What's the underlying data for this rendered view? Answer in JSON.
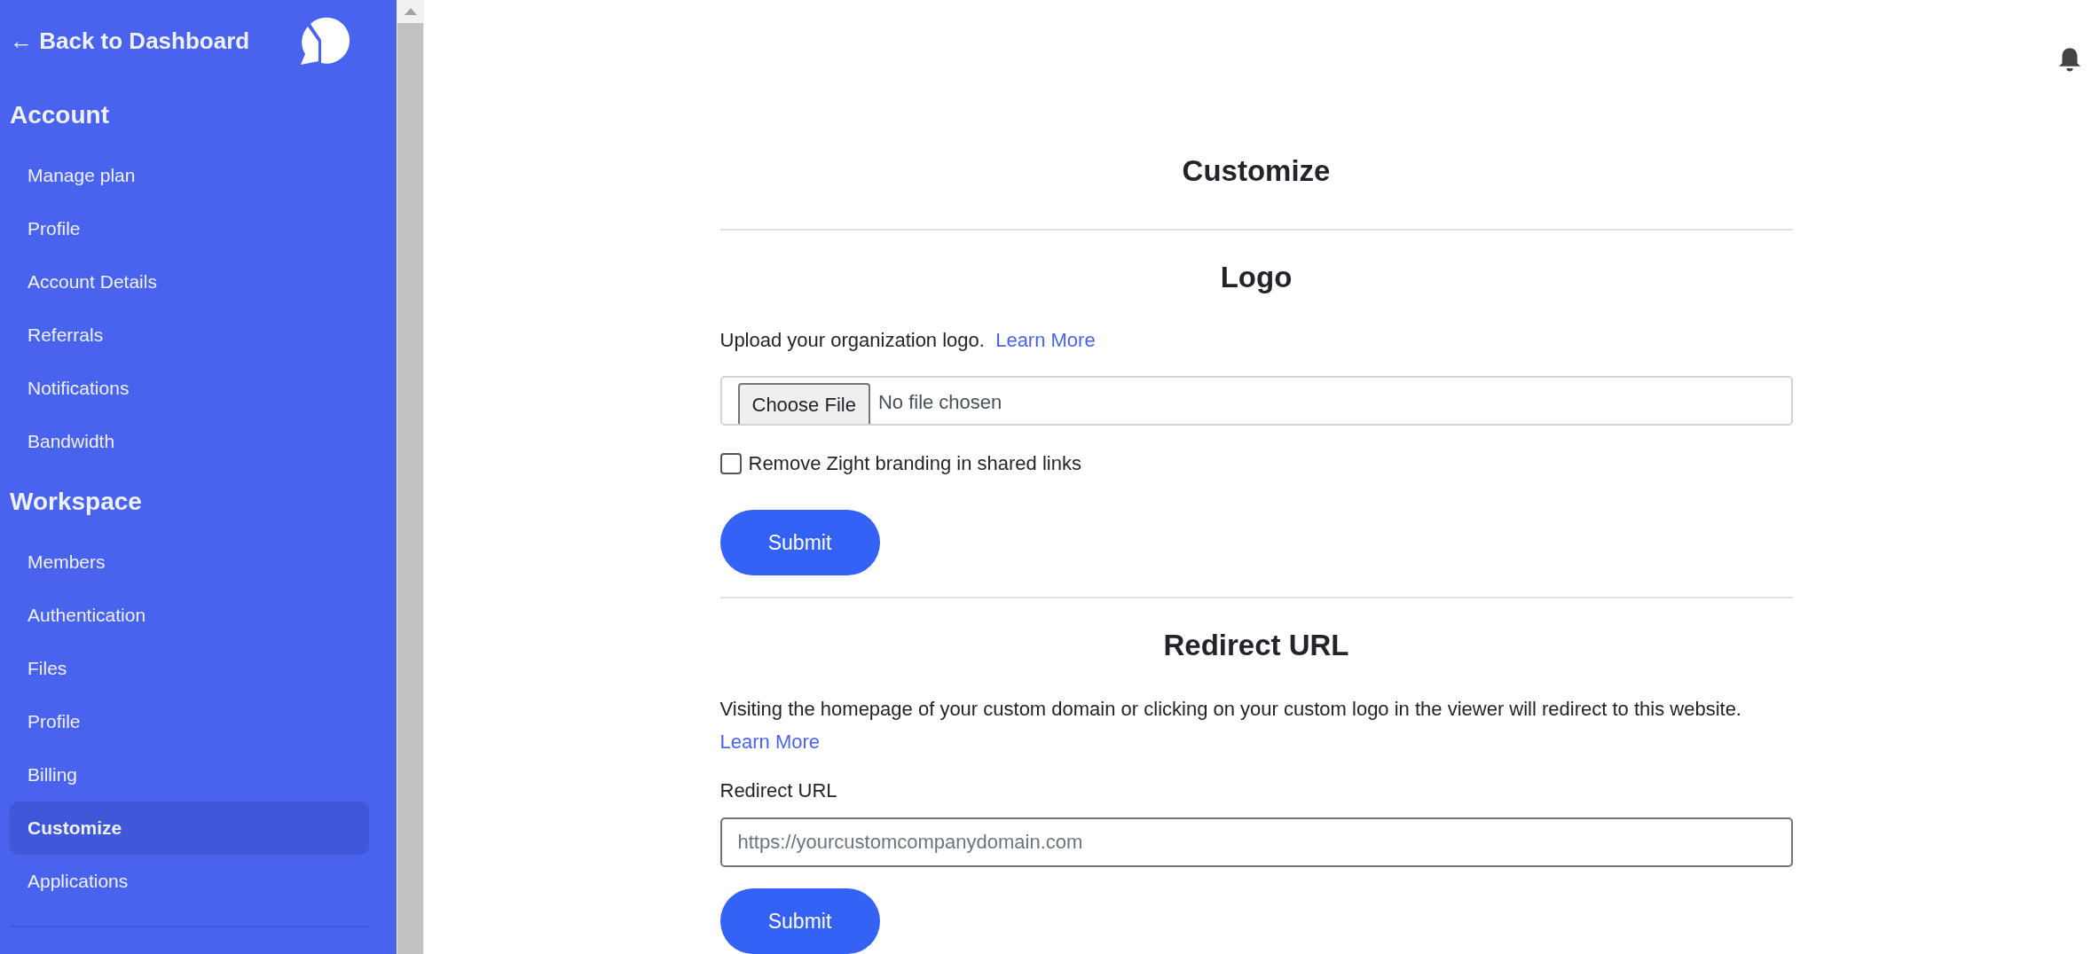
{
  "sidebar": {
    "back_link": "← Back to Dashboard",
    "sections": [
      {
        "title": "Account",
        "items": [
          {
            "label": "Manage plan",
            "selected": false
          },
          {
            "label": "Profile",
            "selected": false
          },
          {
            "label": "Account Details",
            "selected": false
          },
          {
            "label": "Referrals",
            "selected": false
          },
          {
            "label": "Notifications",
            "selected": false
          },
          {
            "label": "Bandwidth",
            "selected": false
          }
        ]
      },
      {
        "title": "Workspace",
        "items": [
          {
            "label": "Members",
            "selected": false
          },
          {
            "label": "Authentication",
            "selected": false
          },
          {
            "label": "Files",
            "selected": false
          },
          {
            "label": "Profile",
            "selected": false
          },
          {
            "label": "Billing",
            "selected": false
          },
          {
            "label": "Customize",
            "selected": true
          },
          {
            "label": "Applications",
            "selected": false
          }
        ]
      }
    ]
  },
  "page": {
    "title": "Customize",
    "logo_section": {
      "title": "Logo",
      "description": "Upload your organization logo.",
      "link": "Learn More",
      "file_button": "Choose File",
      "file_status": "No file chosen",
      "checkbox": {
        "label": "Remove Zight branding in shared links",
        "checked": false
      },
      "submit": "Submit"
    },
    "redirect_section": {
      "title": "Redirect URL",
      "description": "Visiting the homepage of your custom domain or clicking on your custom logo in the viewer will redirect to this website.",
      "link": "Learn More",
      "field_label": "Redirect URL",
      "placeholder": "https://yourcustomcompanydomain.com",
      "submit": "Submit"
    }
  }
}
